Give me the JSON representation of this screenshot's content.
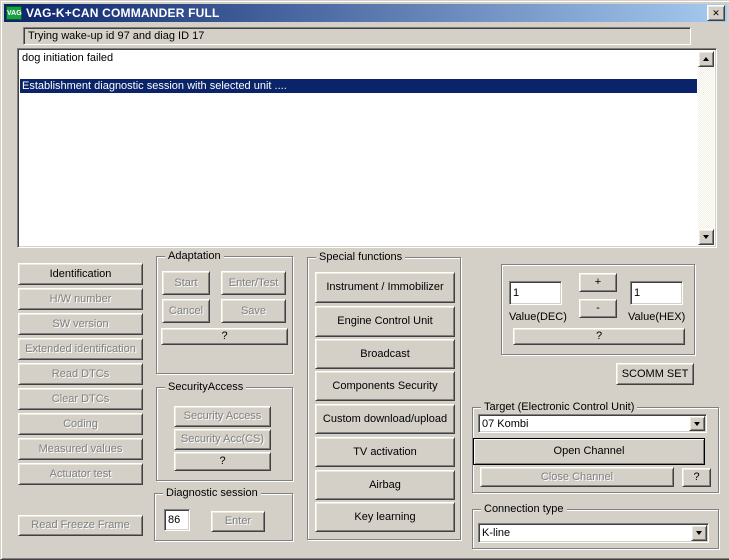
{
  "window": {
    "title": "VAG-K+CAN COMMANDER FULL",
    "icon_text": "VAG"
  },
  "icons": {
    "close": "✕",
    "dropdown_arrow": "▼",
    "scroll_up": "▲",
    "scroll_down": "▼"
  },
  "colors": {
    "face": "#d4d0c8",
    "title_gradient_left": "#0a246a",
    "title_gradient_right": "#a6caf0",
    "selection": "#0a246a",
    "disabled_text": "#808080",
    "icon_green": "#18a046"
  },
  "status_bar": {
    "text": "Trying wake-up id 97 and diag ID 17"
  },
  "log": {
    "rows": [
      "dog initiation failed",
      "",
      "Establishment diagnostic session with selected unit ...."
    ],
    "selected_index": 2
  },
  "left_buttons": [
    {
      "label": "Identification",
      "enabled": true
    },
    {
      "label": "H/W number",
      "enabled": false
    },
    {
      "label": "SW version",
      "enabled": false
    },
    {
      "label": "Extended identification",
      "enabled": false
    },
    {
      "label": "Read DTCs",
      "enabled": false
    },
    {
      "label": "Clear DTCs",
      "enabled": false
    },
    {
      "label": "Coding",
      "enabled": false
    },
    {
      "label": "Measured values",
      "enabled": false
    },
    {
      "label": "Actuator test",
      "enabled": false
    },
    {
      "label": "Read Freeze Frame",
      "enabled": false
    }
  ],
  "adaptation": {
    "title": "Adaptation",
    "start": "Start",
    "enter_test": "Enter/Test",
    "cancel": "Cancel",
    "save": "Save",
    "help": "?"
  },
  "security_access": {
    "title": "SecurityAccess",
    "access": "Security Access",
    "access_cs": "Security Acc(CS)",
    "help": "?"
  },
  "diagnostic_session": {
    "title": "Diagnostic session",
    "value": "86",
    "enter": "Enter"
  },
  "special_functions": {
    "title": "Special functions",
    "buttons": [
      "Instrument / Immobilizer",
      "Engine Control Unit",
      "Broadcast",
      "Components Security",
      "Custom download/upload",
      "TV activation",
      "Airbag",
      "Key learning"
    ]
  },
  "value_panel": {
    "dec_value": "1",
    "hex_value": "1",
    "plus": "+",
    "minus": "-",
    "dec_label": "Value(DEC)",
    "hex_label": "Value(HEX)",
    "help": "?"
  },
  "scomm": {
    "label": "SCOMM SET"
  },
  "target": {
    "title": "Target (Electronic Control Unit)",
    "selected": "07 Kombi",
    "open_channel": "Open Channel",
    "close_channel": "Close Channel",
    "help": "?"
  },
  "connection": {
    "title": "Connection type",
    "selected": "K-line"
  }
}
